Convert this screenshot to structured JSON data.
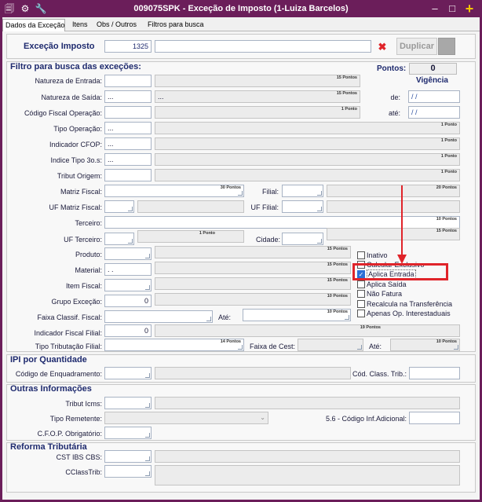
{
  "window": {
    "title": "009075SPK - Exceção de Imposto (1-Luiza Barcelos)",
    "minimize": "‒",
    "maximize": "□",
    "add": "+",
    "app_icon": "🗐",
    "menu_icon": "⚙",
    "tool_icon": "🔧"
  },
  "tabs": [
    {
      "label": "Dados da Exceção"
    },
    {
      "label": "Itens"
    },
    {
      "label": "Obs / Outros"
    },
    {
      "label": "Filtros para busca"
    }
  ],
  "header": {
    "label": "Exceção Imposto",
    "code": "1325",
    "description": "",
    "clear_icon": "✖",
    "duplicar": "Duplicar"
  },
  "filtro": {
    "title": "Filtro para busca das exceções:",
    "pontos_label": "Pontos:",
    "pontos_value": "0",
    "vigencia_label": "Vigência",
    "de_label": "de:",
    "de_value": "/ /",
    "ate_label": "até:",
    "ate_value": "/ /",
    "natureza_entrada": {
      "label": "Natureza de Entrada:",
      "value": "",
      "pts": "15 Pontos"
    },
    "natureza_saida": {
      "label": "Natureza de Saída:",
      "value": "...",
      "desc": "...",
      "pts": "15 Pontos"
    },
    "codigo_fiscal": {
      "label": "Código Fiscal Operação:",
      "value": "",
      "pts": "1 Ponto"
    },
    "tipo_operacao": {
      "label": "Tipo Operação:",
      "value": "...",
      "pts": "1 Ponto"
    },
    "indicador_cfop": {
      "label": "Indicador CFOP:",
      "value": "...",
      "pts": "1 Ponto"
    },
    "indice_tipo": {
      "label": "Indice Tipo 3o.s:",
      "value": "...",
      "pts": "1 Ponto"
    },
    "tribut_origem": {
      "label": "Tribut Origem:",
      "value": "",
      "pts": "1 Ponto"
    },
    "matriz_fiscal": {
      "label": "Matriz Fiscal:",
      "pts": "30 Pontos"
    },
    "filial": {
      "label": "Filial:",
      "pts": "20 Pontos"
    },
    "uf_matriz": {
      "label": "UF Matriz Fiscal:"
    },
    "uf_filial": {
      "label": "UF Filial:"
    },
    "terceiro": {
      "label": "Terceiro:",
      "pts": "10 Pontos"
    },
    "uf_terceiro": {
      "label": "UF Terceiro:",
      "pts": "1 Ponto"
    },
    "cidade": {
      "label": "Cidade:",
      "pts": "15 Pontos"
    },
    "produto": {
      "label": "Produto:",
      "pts": "15 Pontos"
    },
    "material": {
      "label": "Material:",
      "value": ". .",
      "pts": "15 Pontos"
    },
    "item_fiscal": {
      "label": "Item Fiscal:",
      "pts": "15 Pontos"
    },
    "grupo_excecao": {
      "label": "Grupo Exceção:",
      "value": "0",
      "pts": "10 Pontos"
    },
    "faixa_classif": {
      "label": "Faixa Classif. Fiscal:",
      "ate": "Até:",
      "pts": "10 Pontos"
    },
    "indicador_fiscal": {
      "label": "Indicador Fiscal Filial:",
      "value": "0",
      "pts": "19 Pontos"
    },
    "tipo_tributacao": {
      "label": "Tipo Tributação Filial:",
      "pts": "14 Pontos"
    },
    "faixa_cest": {
      "label": "Faixa de Cest:",
      "ate": "Até:",
      "pts": "10 Pontos"
    },
    "checks": [
      {
        "label": "Inativo",
        "checked": false
      },
      {
        "label": "Calcular Exclusivo",
        "checked": false
      },
      {
        "label": "Aplica Entrada",
        "checked": true
      },
      {
        "label": "Aplica Saída",
        "checked": false
      },
      {
        "label": "Não Fatura",
        "checked": false
      },
      {
        "label": "Recalcula na Transferência",
        "checked": false
      },
      {
        "label": "Apenas Op. Interestaduais",
        "checked": false
      }
    ],
    "highlight_color": "#e0242a"
  },
  "ipi": {
    "title": "IPI por Quantidade",
    "codigo_enq": "Código de Enquadramento:",
    "cod_class": "Cód. Class. Trib.:"
  },
  "outras": {
    "title": "Outras Informações",
    "tribut_icms": "Tribut Icms:",
    "tipo_remetente": "Tipo Remetente:",
    "codigo_inf": "5.6 - Código Inf.Adicional:",
    "cfop_obrig": "C.F.O.P. Obrigatório:"
  },
  "reforma": {
    "title": "Reforma Tributária",
    "cst": "CST IBS CBS:",
    "cclass": "CClassTrib:"
  }
}
